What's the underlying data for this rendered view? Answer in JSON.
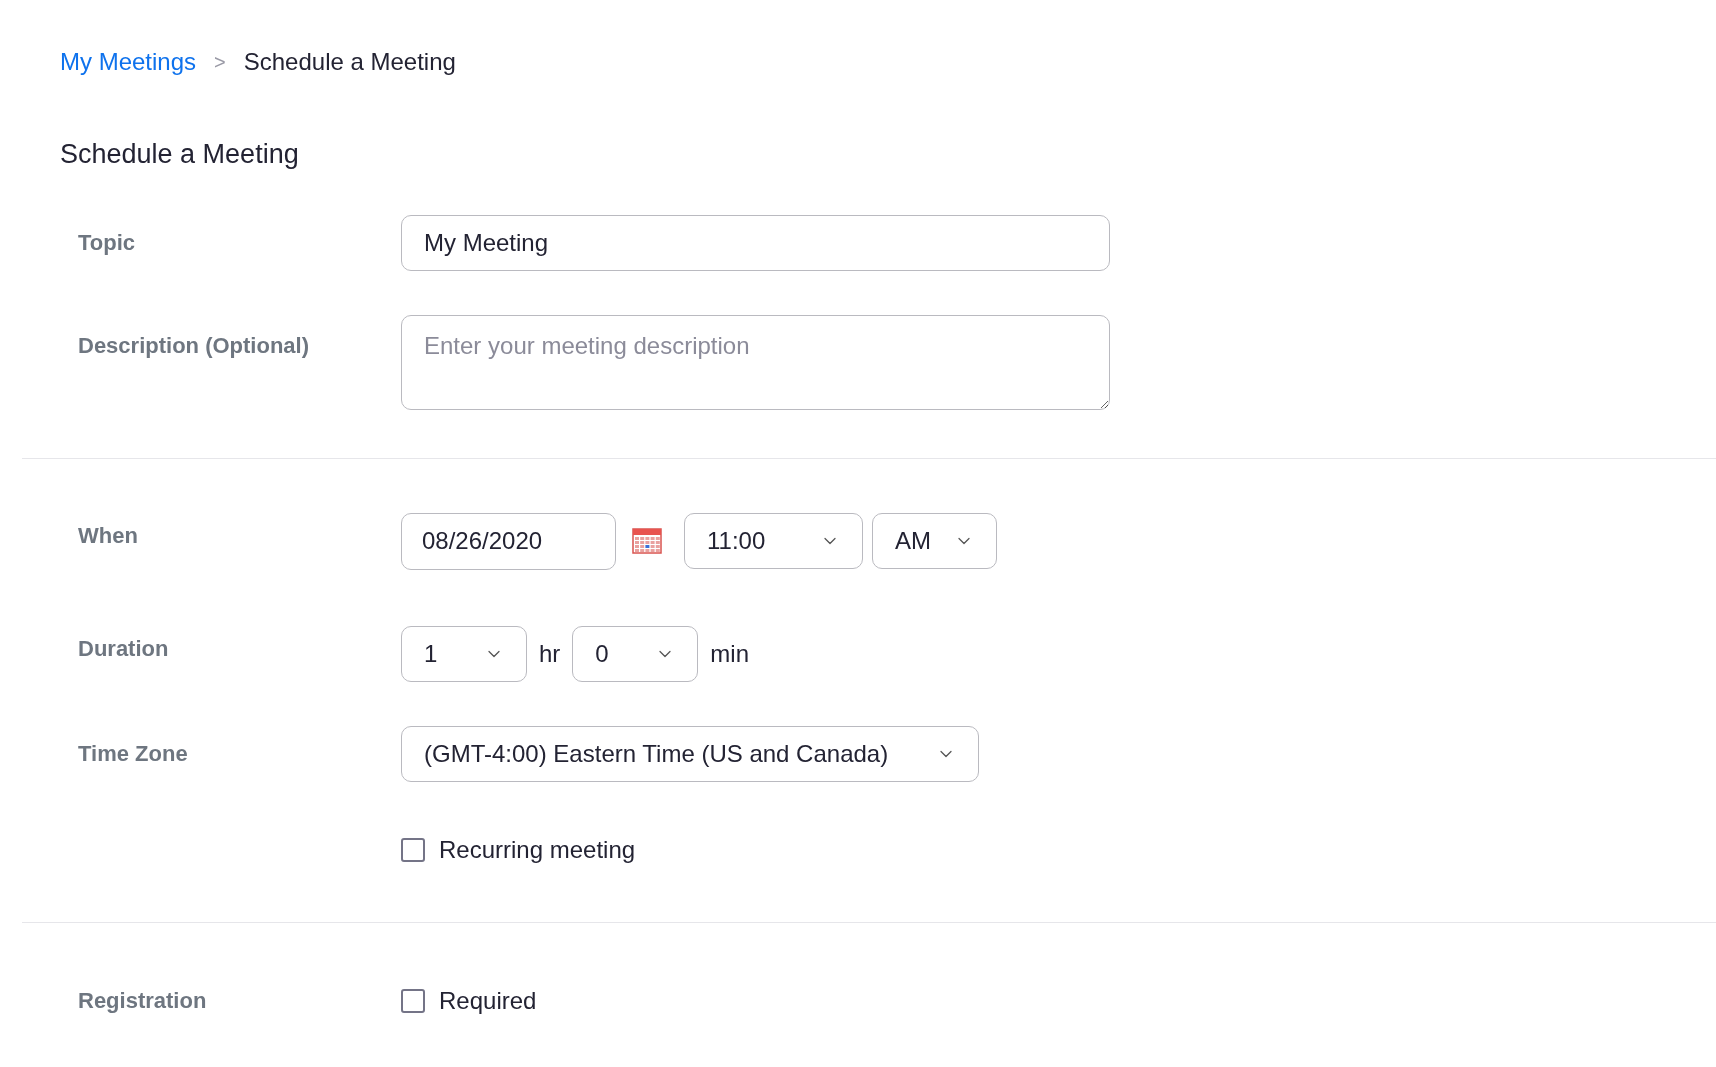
{
  "breadcrumb": [
    {
      "label": "My Meetings",
      "kind": "link"
    },
    {
      "label": "Schedule a Meeting",
      "kind": "current"
    }
  ],
  "breadcrumb_separator": ">",
  "title": "Schedule a Meeting",
  "topic": {
    "label": "Topic",
    "value": "My Meeting"
  },
  "description": {
    "label": "Description (Optional)",
    "placeholder": "Enter your meeting description"
  },
  "when": {
    "label": "When",
    "date": "08/26/2020",
    "time": "11:00",
    "ampm": "AM"
  },
  "duration": {
    "label": "Duration",
    "hours": "1",
    "hours_unit": "hr",
    "minutes": "0",
    "minutes_unit": "min"
  },
  "time_zone": {
    "label": "Time Zone",
    "value": "(GMT-4:00) Eastern Time (US and Canada)"
  },
  "recurring": {
    "label": "Recurring meeting",
    "checked": false
  },
  "registration": {
    "label": "Registration",
    "option": "Required",
    "checked": false
  }
}
